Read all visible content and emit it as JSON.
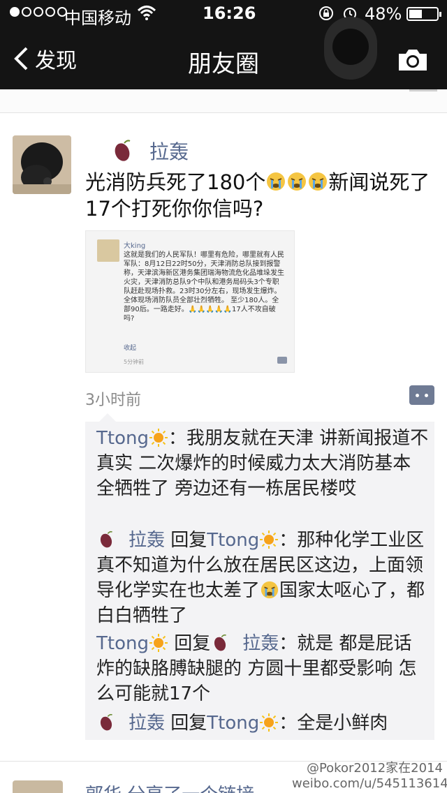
{
  "status_bar": {
    "carrier": "中国移动",
    "time": "16:26",
    "battery": "48%",
    "battery_level": 0.48
  },
  "nav": {
    "back_label": "发现",
    "title": "朋友圈"
  },
  "post": {
    "author": "拉轰",
    "text_part1": "光消防兵死了180个",
    "text_part2": "新闻说死了17个打死你你信吗?",
    "time": "3小时前",
    "screenshot": {
      "name": "大king",
      "body": "这就是我们的人民军队！哪里有危险，哪里就有人民军队：8月12日22时50分，天津消防总队接到报警称，天津滨海新区港务集团瑞海物流危化品堆垛发生火灾，天津消防总队9个中队和港务局码头3个专职队赶赴现场扑救。23时30分左右，现场发生爆炸。全体现场消防队员全部壮烈牺牲。   至少180人。全部90后。一路走好。🙏🙏🙏🙏🙏17人不攻自破吗?",
      "fold": "收起",
      "time": "5分钟前"
    }
  },
  "comments": [
    {
      "name": "Ttong",
      "text": "：我朋友就在天津 讲新闻报道不真实 二次爆炸的时候威力太大消防基本全牺牲了 旁边还有一栋居民楼哎"
    },
    {
      "name": "拉轰",
      "reply_word": "回复",
      "reply_to": "Ttong",
      "text_a": "：那种化学工业区真不知道为什么放在居民区这边，上面领导化学实在也太差了",
      "text_b": "国家太呕心了，都白白牺牲了"
    },
    {
      "name": "Ttong",
      "reply_word": "回复",
      "reply_to": "拉轰",
      "text": "：就是 都是屁话 炸的缺胳膊缺腿的 方圆十里都受影响 怎么可能就17个"
    },
    {
      "name": "拉轰",
      "reply_word": "回复",
      "reply_to": "Ttong",
      "text": "：全是小鲜肉"
    }
  ],
  "next_post": {
    "text": "郭华 分享了一个链接"
  },
  "watermark": {
    "line1": "@Pokor2012家在2014",
    "line2": "weibo.com/u/5451136140"
  },
  "colors": {
    "name_link": "#56688e",
    "nav_bg": "#141414"
  },
  "icons": [
    "back-chevron-icon",
    "camera-icon",
    "wifi-icon",
    "lock-icon",
    "alarm-icon",
    "sweet-potato-icon",
    "sun-icon",
    "crying-face-icon",
    "comment-icon"
  ]
}
